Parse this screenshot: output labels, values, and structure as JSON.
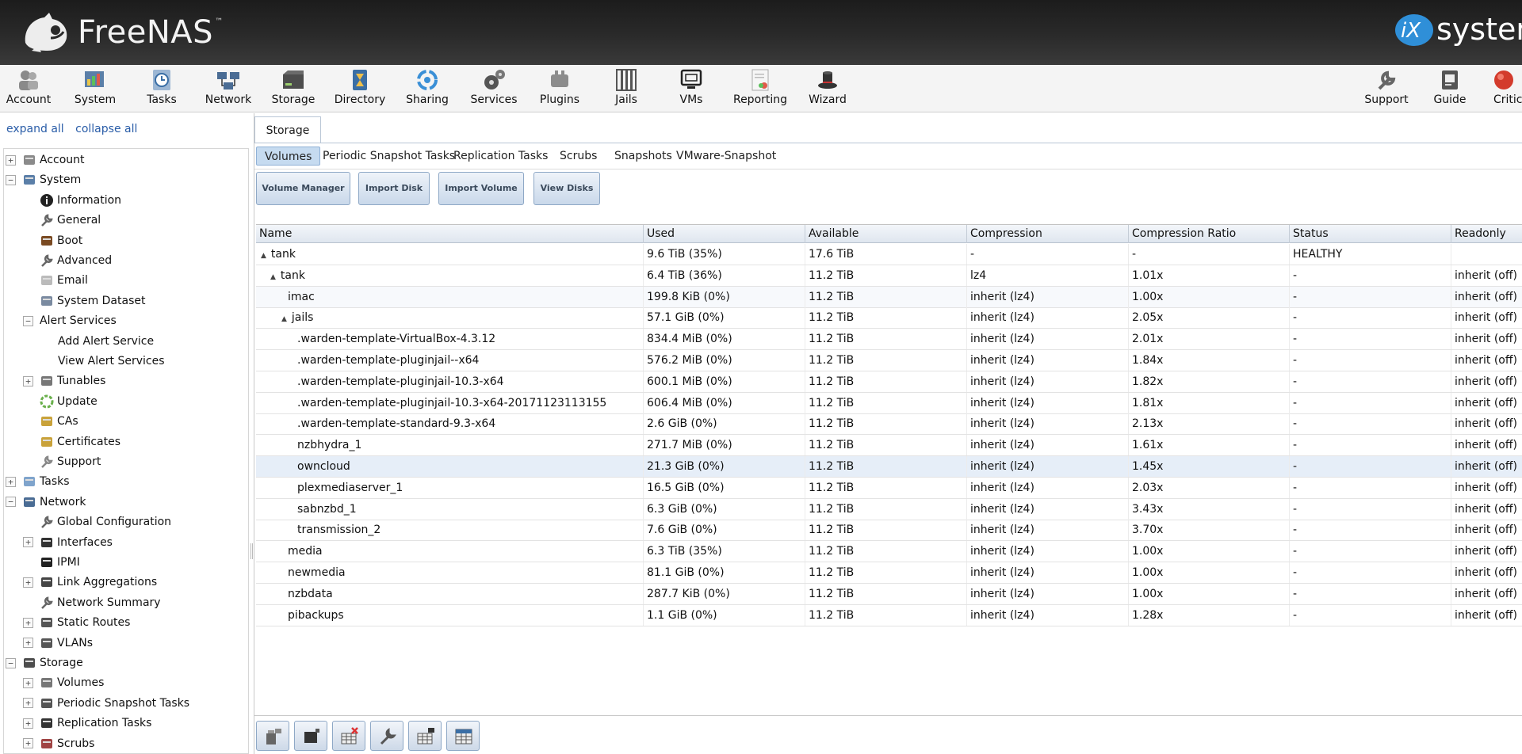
{
  "header": {
    "brand": "FreeNAS",
    "brand_tm": "™",
    "vendor": "systems"
  },
  "toolbar": [
    {
      "label": "Account",
      "icon": "account-icon"
    },
    {
      "label": "System",
      "icon": "system-icon"
    },
    {
      "label": "Tasks",
      "icon": "tasks-icon"
    },
    {
      "label": "Network",
      "icon": "network-icon"
    },
    {
      "label": "Storage",
      "icon": "storage-icon"
    },
    {
      "label": "Directory",
      "icon": "directory-icon"
    },
    {
      "label": "Sharing",
      "icon": "sharing-icon"
    },
    {
      "label": "Services",
      "icon": "services-icon"
    },
    {
      "label": "Plugins",
      "icon": "plugins-icon"
    },
    {
      "label": "Jails",
      "icon": "jails-icon"
    },
    {
      "label": "VMs",
      "icon": "vms-icon"
    },
    {
      "label": "Reporting",
      "icon": "reporting-icon"
    },
    {
      "label": "Wizard",
      "icon": "wizard-icon"
    },
    {
      "label": "Support",
      "icon": "support-icon"
    },
    {
      "label": "Guide",
      "icon": "guide-icon"
    },
    {
      "label": "Critical",
      "icon": "critical-alert-icon"
    }
  ],
  "sidebar": {
    "expand_all": "expand all",
    "collapse_all": "collapse all",
    "tree": [
      {
        "label": "Account",
        "expander": "+",
        "icon": "account-icon",
        "depth": 0
      },
      {
        "label": "System",
        "expander": "−",
        "icon": "system-icon",
        "depth": 0
      },
      {
        "label": "Information",
        "icon": "info-icon",
        "depth": 1
      },
      {
        "label": "General",
        "icon": "wrench-icon",
        "depth": 1
      },
      {
        "label": "Boot",
        "icon": "boot-icon",
        "depth": 1
      },
      {
        "label": "Advanced",
        "icon": "wrench-icon",
        "depth": 1
      },
      {
        "label": "Email",
        "icon": "email-icon",
        "depth": 1
      },
      {
        "label": "System Dataset",
        "icon": "dataset-icon",
        "depth": 1
      },
      {
        "label": "Alert Services",
        "expander": "−",
        "depth": 1
      },
      {
        "label": "Add Alert Service",
        "depth": 2
      },
      {
        "label": "View Alert Services",
        "depth": 2
      },
      {
        "label": "Tunables",
        "expander": "+",
        "icon": "tunables-icon",
        "depth": 1
      },
      {
        "label": "Update",
        "icon": "update-icon",
        "depth": 1
      },
      {
        "label": "CAs",
        "icon": "ca-icon",
        "depth": 1
      },
      {
        "label": "Certificates",
        "icon": "certificate-icon",
        "depth": 1
      },
      {
        "label": "Support",
        "icon": "support-icon",
        "depth": 1
      },
      {
        "label": "Tasks",
        "expander": "+",
        "icon": "tasks-icon",
        "depth": 0
      },
      {
        "label": "Network",
        "expander": "−",
        "icon": "network-icon",
        "depth": 0
      },
      {
        "label": "Global Configuration",
        "icon": "wrench-icon",
        "depth": 1
      },
      {
        "label": "Interfaces",
        "expander": "+",
        "icon": "interface-icon",
        "depth": 1
      },
      {
        "label": "IPMI",
        "icon": "ipmi-icon",
        "depth": 1
      },
      {
        "label": "Link Aggregations",
        "expander": "+",
        "icon": "lagg-icon",
        "depth": 1
      },
      {
        "label": "Network Summary",
        "icon": "wrench-icon",
        "depth": 1
      },
      {
        "label": "Static Routes",
        "expander": "+",
        "icon": "routes-icon",
        "depth": 1
      },
      {
        "label": "VLANs",
        "expander": "+",
        "icon": "vlan-icon",
        "depth": 1
      },
      {
        "label": "Storage",
        "expander": "−",
        "icon": "storage-icon",
        "depth": 0
      },
      {
        "label": "Volumes",
        "expander": "+",
        "icon": "volumes-icon",
        "depth": 1
      },
      {
        "label": "Periodic Snapshot Tasks",
        "expander": "+",
        "icon": "snapshot-icon",
        "depth": 1
      },
      {
        "label": "Replication Tasks",
        "expander": "+",
        "icon": "replication-icon",
        "depth": 1
      },
      {
        "label": "Scrubs",
        "expander": "+",
        "icon": "scrub-icon",
        "depth": 1
      }
    ]
  },
  "content": {
    "main_tab": "Storage",
    "sub_tabs": [
      "Volumes",
      "Periodic Snapshot Tasks",
      "Replication Tasks",
      "Scrubs",
      "Snapshots",
      "VMware-Snapshot"
    ],
    "buttons": [
      "Volume Manager",
      "Import Disk",
      "Import Volume",
      "View Disks"
    ],
    "columns": [
      "Name",
      "Used",
      "Available",
      "Compression",
      "Compression Ratio",
      "Status",
      "Readonly"
    ],
    "rows": [
      {
        "name": "tank",
        "twisty": "▲",
        "used": "9.6 TiB (35%)",
        "available": "17.6 TiB",
        "compression": "-",
        "ratio": "-",
        "status": "HEALTHY",
        "readonly": ""
      },
      {
        "name": "tank",
        "twisty": "▲",
        "used": "6.4 TiB (36%)",
        "available": "11.2 TiB",
        "compression": "lz4",
        "ratio": "1.01x",
        "status": "-",
        "readonly": "inherit (off)"
      },
      {
        "name": "imac",
        "twisty": "",
        "used": "199.8 KiB (0%)",
        "available": "11.2 TiB",
        "compression": "inherit (lz4)",
        "ratio": "1.00x",
        "status": "-",
        "readonly": "inherit (off)"
      },
      {
        "name": "jails",
        "twisty": "▲",
        "used": "57.1 GiB (0%)",
        "available": "11.2 TiB",
        "compression": "inherit (lz4)",
        "ratio": "2.05x",
        "status": "-",
        "readonly": "inherit (off)"
      },
      {
        "name": ".warden-template-VirtualBox-4.3.12",
        "twisty": "",
        "used": "834.4 MiB (0%)",
        "available": "11.2 TiB",
        "compression": "inherit (lz4)",
        "ratio": "2.01x",
        "status": "-",
        "readonly": "inherit (off)"
      },
      {
        "name": ".warden-template-pluginjail--x64",
        "twisty": "",
        "used": "576.2 MiB (0%)",
        "available": "11.2 TiB",
        "compression": "inherit (lz4)",
        "ratio": "1.84x",
        "status": "-",
        "readonly": "inherit (off)"
      },
      {
        "name": ".warden-template-pluginjail-10.3-x64",
        "twisty": "",
        "used": "600.1 MiB (0%)",
        "available": "11.2 TiB",
        "compression": "inherit (lz4)",
        "ratio": "1.82x",
        "status": "-",
        "readonly": "inherit (off)"
      },
      {
        "name": ".warden-template-pluginjail-10.3-x64-20171123113155",
        "twisty": "",
        "used": "606.4 MiB (0%)",
        "available": "11.2 TiB",
        "compression": "inherit (lz4)",
        "ratio": "1.81x",
        "status": "-",
        "readonly": "inherit (off)"
      },
      {
        "name": ".warden-template-standard-9.3-x64",
        "twisty": "",
        "used": "2.6 GiB (0%)",
        "available": "11.2 TiB",
        "compression": "inherit (lz4)",
        "ratio": "2.13x",
        "status": "-",
        "readonly": "inherit (off)"
      },
      {
        "name": "nzbhydra_1",
        "twisty": "",
        "used": "271.7 MiB (0%)",
        "available": "11.2 TiB",
        "compression": "inherit (lz4)",
        "ratio": "1.61x",
        "status": "-",
        "readonly": "inherit (off)"
      },
      {
        "name": "owncloud",
        "twisty": "",
        "used": "21.3 GiB (0%)",
        "available": "11.2 TiB",
        "compression": "inherit (lz4)",
        "ratio": "1.45x",
        "status": "-",
        "readonly": "inherit (off)"
      },
      {
        "name": "plexmediaserver_1",
        "twisty": "",
        "used": "16.5 GiB (0%)",
        "available": "11.2 TiB",
        "compression": "inherit (lz4)",
        "ratio": "2.03x",
        "status": "-",
        "readonly": "inherit (off)"
      },
      {
        "name": "sabnzbd_1",
        "twisty": "",
        "used": "6.3 GiB (0%)",
        "available": "11.2 TiB",
        "compression": "inherit (lz4)",
        "ratio": "3.43x",
        "status": "-",
        "readonly": "inherit (off)"
      },
      {
        "name": "transmission_2",
        "twisty": "",
        "used": "7.6 GiB (0%)",
        "available": "11.2 TiB",
        "compression": "inherit (lz4)",
        "ratio": "3.70x",
        "status": "-",
        "readonly": "inherit (off)"
      },
      {
        "name": "media",
        "twisty": "",
        "used": "6.3 TiB (35%)",
        "available": "11.2 TiB",
        "compression": "inherit (lz4)",
        "ratio": "1.00x",
        "status": "-",
        "readonly": "inherit (off)"
      },
      {
        "name": "newmedia",
        "twisty": "",
        "used": "81.1 GiB (0%)",
        "available": "11.2 TiB",
        "compression": "inherit (lz4)",
        "ratio": "1.00x",
        "status": "-",
        "readonly": "inherit (off)"
      },
      {
        "name": "nzbdata",
        "twisty": "",
        "used": "287.7 KiB (0%)",
        "available": "11.2 TiB",
        "compression": "inherit (lz4)",
        "ratio": "1.00x",
        "status": "-",
        "readonly": "inherit (off)"
      },
      {
        "name": "pibackups",
        "twisty": "",
        "used": "1.1 GiB (0%)",
        "available": "11.2 TiB",
        "compression": "inherit (lz4)",
        "ratio": "1.28x",
        "status": "-",
        "readonly": "inherit (off)"
      }
    ],
    "bottom_actions": [
      "Detach Volume",
      "Scrub Volume",
      "Delete Dataset",
      "Edit Options",
      "Create Dataset",
      "Create zvol"
    ]
  },
  "colors": {
    "header_bg": "#2a2a2a",
    "accent_blue": "#2a5da8",
    "selected_tab": "#c6dbf0",
    "critical_red": "#d33b2c"
  }
}
